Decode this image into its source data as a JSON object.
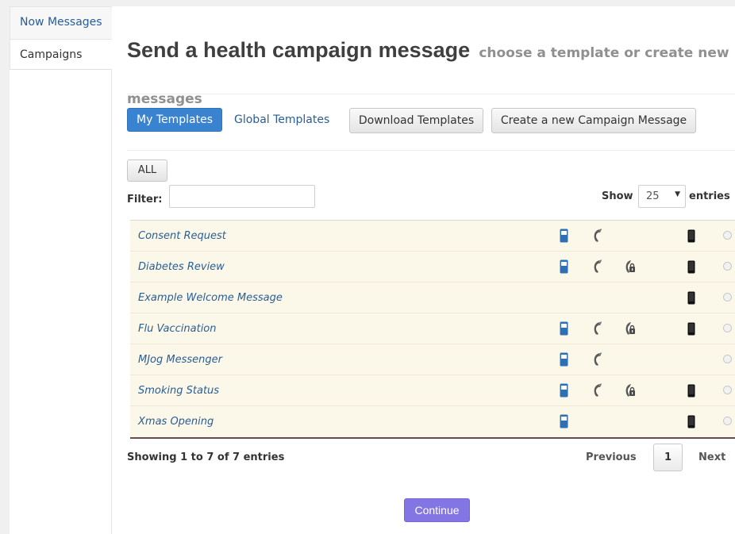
{
  "tabs": [
    {
      "label": "Now Messages"
    },
    {
      "label": "Campaigns"
    }
  ],
  "header": {
    "title": "Send a health campaign message",
    "subtitle": "choose a template or create new messages"
  },
  "toolbar": {
    "my_templates": "My Templates",
    "global_templates": "Global Templates",
    "download_templates": "Download Templates",
    "create_campaign": "Create a new Campaign Message"
  },
  "filters": {
    "all_label": "ALL",
    "filter_label": "Filter:",
    "filter_value": "",
    "show_label": "Show",
    "page_size": "25",
    "entries_label": "entries"
  },
  "colors": {
    "primary": "#3a83d1",
    "link": "#2a5d95",
    "row_bg": "#fcf8e9",
    "continue": "#8375e3"
  },
  "templates": [
    {
      "name": "Consent Request",
      "sms": true,
      "voice": true,
      "secure_voice": false,
      "mobile": true,
      "selected": false
    },
    {
      "name": "Diabetes Review",
      "sms": true,
      "voice": true,
      "secure_voice": true,
      "mobile": true,
      "selected": false
    },
    {
      "name": "Example Welcome Message",
      "sms": false,
      "voice": false,
      "secure_voice": false,
      "mobile": true,
      "selected": false
    },
    {
      "name": "Flu Vaccination",
      "sms": true,
      "voice": true,
      "secure_voice": true,
      "mobile": true,
      "selected": false
    },
    {
      "name": "MJog Messenger",
      "sms": true,
      "voice": true,
      "secure_voice": false,
      "mobile": false,
      "selected": false
    },
    {
      "name": "Smoking Status",
      "sms": true,
      "voice": true,
      "secure_voice": true,
      "mobile": true,
      "selected": false
    },
    {
      "name": "Xmas Opening",
      "sms": true,
      "voice": false,
      "secure_voice": false,
      "mobile": true,
      "selected": false
    }
  ],
  "icons": {
    "sms": "sms-phone-icon",
    "voice": "voice-call-icon",
    "secure_voice": "secure-voice-icon",
    "mobile": "mobile-app-icon"
  },
  "pagination": {
    "summary": "Showing 1 to 7 of 7 entries",
    "previous": "Previous",
    "current_page": "1",
    "next": "Next"
  },
  "actions": {
    "continue": "Continue"
  }
}
